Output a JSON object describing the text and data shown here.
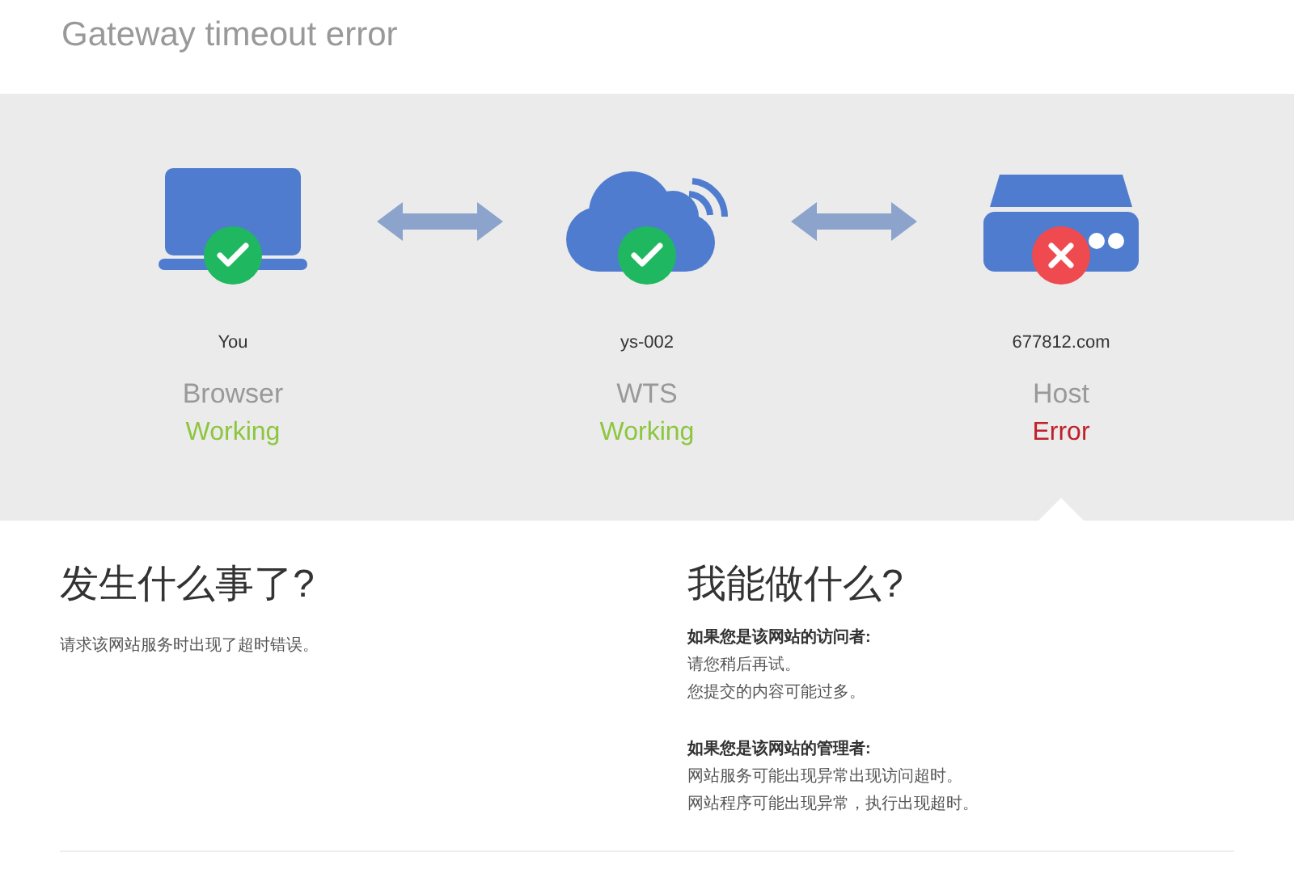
{
  "title": "Gateway timeout error",
  "nodes": [
    {
      "kind": "laptop",
      "host": "You",
      "name": "Browser",
      "status": "Working",
      "ok": true,
      "selected": false
    },
    {
      "kind": "cloud",
      "host": "ys-002",
      "name": "WTS",
      "status": "Working",
      "ok": true,
      "selected": false
    },
    {
      "kind": "server",
      "host": "677812.com",
      "name": "Host",
      "status": "Error",
      "ok": false,
      "selected": true
    }
  ],
  "left": {
    "heading": "发生什么事了?",
    "text": "请求该网站服务时出现了超时错误。"
  },
  "right": {
    "heading": "我能做什么?",
    "groups": [
      {
        "title": "如果您是该网站的访问者:",
        "lines": [
          "请您稍后再试。",
          "您提交的内容可能过多。"
        ]
      },
      {
        "title": "如果您是该网站的管理者:",
        "lines": [
          "网站服务可能出现异常出现访问超时。",
          "网站程序可能出现异常，执行出现超时。"
        ]
      }
    ]
  }
}
